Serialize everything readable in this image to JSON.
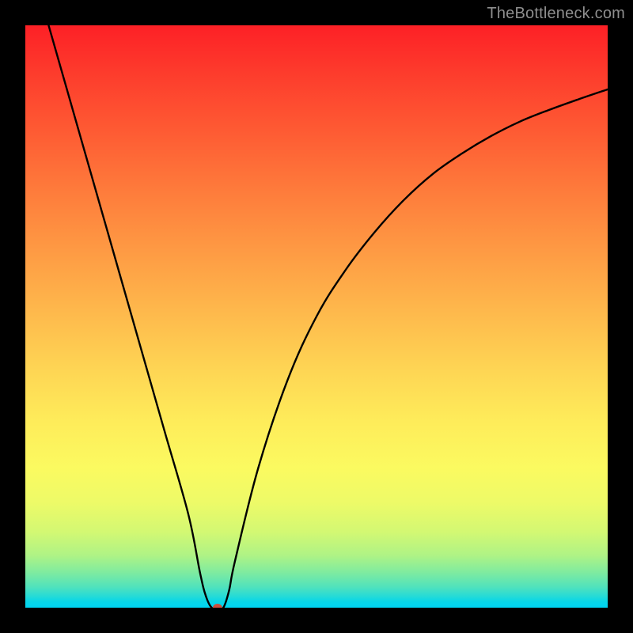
{
  "watermark": {
    "text": "TheBottleneck.com"
  },
  "colors": {
    "curve": "#000000",
    "dot": "#cc4f3e",
    "frame": "#000000"
  },
  "chart_data": {
    "type": "line",
    "title": "",
    "xlabel": "",
    "ylabel": "",
    "xlim": [
      0,
      100
    ],
    "ylim": [
      0,
      100
    ],
    "grid": false,
    "series": [
      {
        "name": "bottleneck-curve",
        "x": [
          4,
          8,
          12,
          16,
          20,
          24,
          28,
          30,
          31,
          32,
          33,
          34,
          35,
          36,
          40,
          45,
          50,
          55,
          60,
          65,
          70,
          75,
          80,
          85,
          90,
          95,
          100
        ],
        "values": [
          100,
          86,
          72,
          58,
          44,
          30,
          16,
          6,
          2,
          0,
          0,
          0,
          3,
          8,
          24,
          39,
          50,
          58,
          64.5,
          70,
          74.5,
          78,
          81,
          83.5,
          85.5,
          87.3,
          89
        ]
      }
    ],
    "annotations": [
      {
        "name": "min-dot",
        "x": 33,
        "y": 0
      }
    ]
  }
}
